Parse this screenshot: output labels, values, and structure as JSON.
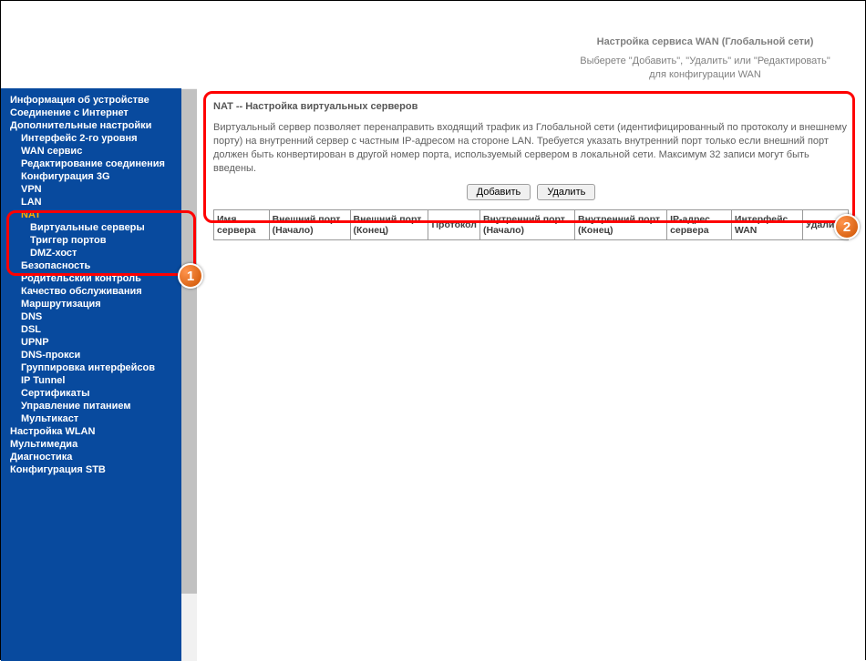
{
  "header": {
    "title": "Настройка сервиса WAN (Глобальной сети)",
    "subtitle": "Выберете \"Добавить\", \"Удалить\" или \"Редактировать\" для конфигурации WAN"
  },
  "sidebar": {
    "items": [
      {
        "label": "Информация об устройстве",
        "level": 0
      },
      {
        "label": "Соединение с Интернет",
        "level": 0
      },
      {
        "label": "Дополнительные настройки",
        "level": 0
      },
      {
        "label": "Интерфейс 2-го уровня",
        "level": 1
      },
      {
        "label": "WAN сервис",
        "level": 1
      },
      {
        "label": "Редактирование соединения",
        "level": 1
      },
      {
        "label": "Конфигурация 3G",
        "level": 1
      },
      {
        "label": "VPN",
        "level": 1
      },
      {
        "label": "LAN",
        "level": 1
      },
      {
        "label": "NAT",
        "level": 1,
        "active": true
      },
      {
        "label": "Виртуальные серверы",
        "level": 2
      },
      {
        "label": "Триггер портов",
        "level": 2
      },
      {
        "label": "DMZ-хост",
        "level": 2
      },
      {
        "label": "Безопасность",
        "level": 1
      },
      {
        "label": "Родительский контроль",
        "level": 1
      },
      {
        "label": "Качество обслуживания",
        "level": 1
      },
      {
        "label": "Маршрутизация",
        "level": 1
      },
      {
        "label": "DNS",
        "level": 1
      },
      {
        "label": "DSL",
        "level": 1
      },
      {
        "label": "UPNP",
        "level": 1
      },
      {
        "label": "DNS-прокси",
        "level": 1
      },
      {
        "label": "Группировка интерфейсов",
        "level": 1
      },
      {
        "label": "IP Tunnel",
        "level": 1
      },
      {
        "label": "Сертификаты",
        "level": 1
      },
      {
        "label": "Управление питанием",
        "level": 1
      },
      {
        "label": "Мультикаст",
        "level": 1
      },
      {
        "label": "Настройка WLAN",
        "level": 0
      },
      {
        "label": "Мультимедиа",
        "level": 0
      },
      {
        "label": "Диагностика",
        "level": 0
      },
      {
        "label": "Конфигурация STB",
        "level": 0
      }
    ]
  },
  "main": {
    "title": "NAT -- Настройка виртуальных серверов",
    "description": "Виртуальный сервер позволяет перенаправить входящий трафик из Глобальной сети (идентифицированный по протоколу и внешнему порту) на внутренний сервер с частным IP-адресом на стороне LAN. Требуется указать внутренний порт только если внешний порт должен быть конвертирован в другой номер порта, используемый сервером в локальной сети. Максимум 32 записи могут быть введены.",
    "buttons": {
      "add": "Добавить",
      "remove": "Удалить"
    },
    "columns": [
      "Имя сервера",
      "Внешний порт (Начало)",
      "Внешний порт (Конец)",
      "Протокол",
      "Внутренний порт (Начало)",
      "Внутренний порт (Конец)",
      "IP-адрес сервера",
      "Интерфейс WAN",
      "Удалить"
    ]
  },
  "markers": {
    "one": "1",
    "two": "2"
  }
}
